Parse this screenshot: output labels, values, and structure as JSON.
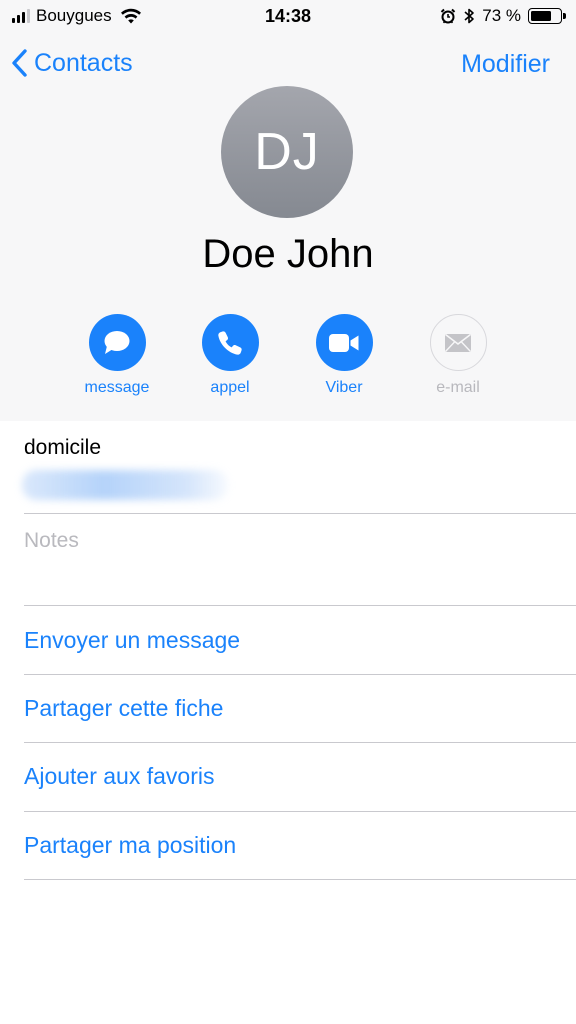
{
  "status_bar": {
    "carrier": "Bouygues",
    "time": "14:38",
    "battery_percent": "73 %",
    "battery_level": 0.73
  },
  "nav": {
    "back_label": "Contacts",
    "edit_label": "Modifier"
  },
  "contact": {
    "initials": "DJ",
    "name": "Doe John"
  },
  "actions": [
    {
      "label": "message",
      "icon": "message-bubble-icon",
      "enabled": true
    },
    {
      "label": "appel",
      "icon": "phone-icon",
      "enabled": true
    },
    {
      "label": "Viber",
      "icon": "video-camera-icon",
      "enabled": true
    },
    {
      "label": "e-mail",
      "icon": "envelope-icon",
      "enabled": false
    }
  ],
  "details": {
    "phone_label": "domicile",
    "notes_placeholder": "Notes"
  },
  "list_actions": [
    "Envoyer un message",
    "Partager cette fiche",
    "Ajouter aux favoris",
    "Partager ma position"
  ],
  "colors": {
    "accent": "#1a82fb",
    "header_bg": "#f7f7f8",
    "avatar_bg": "#8e9199",
    "separator": "#c9c9ce",
    "disabled": "#b8b8bd"
  }
}
